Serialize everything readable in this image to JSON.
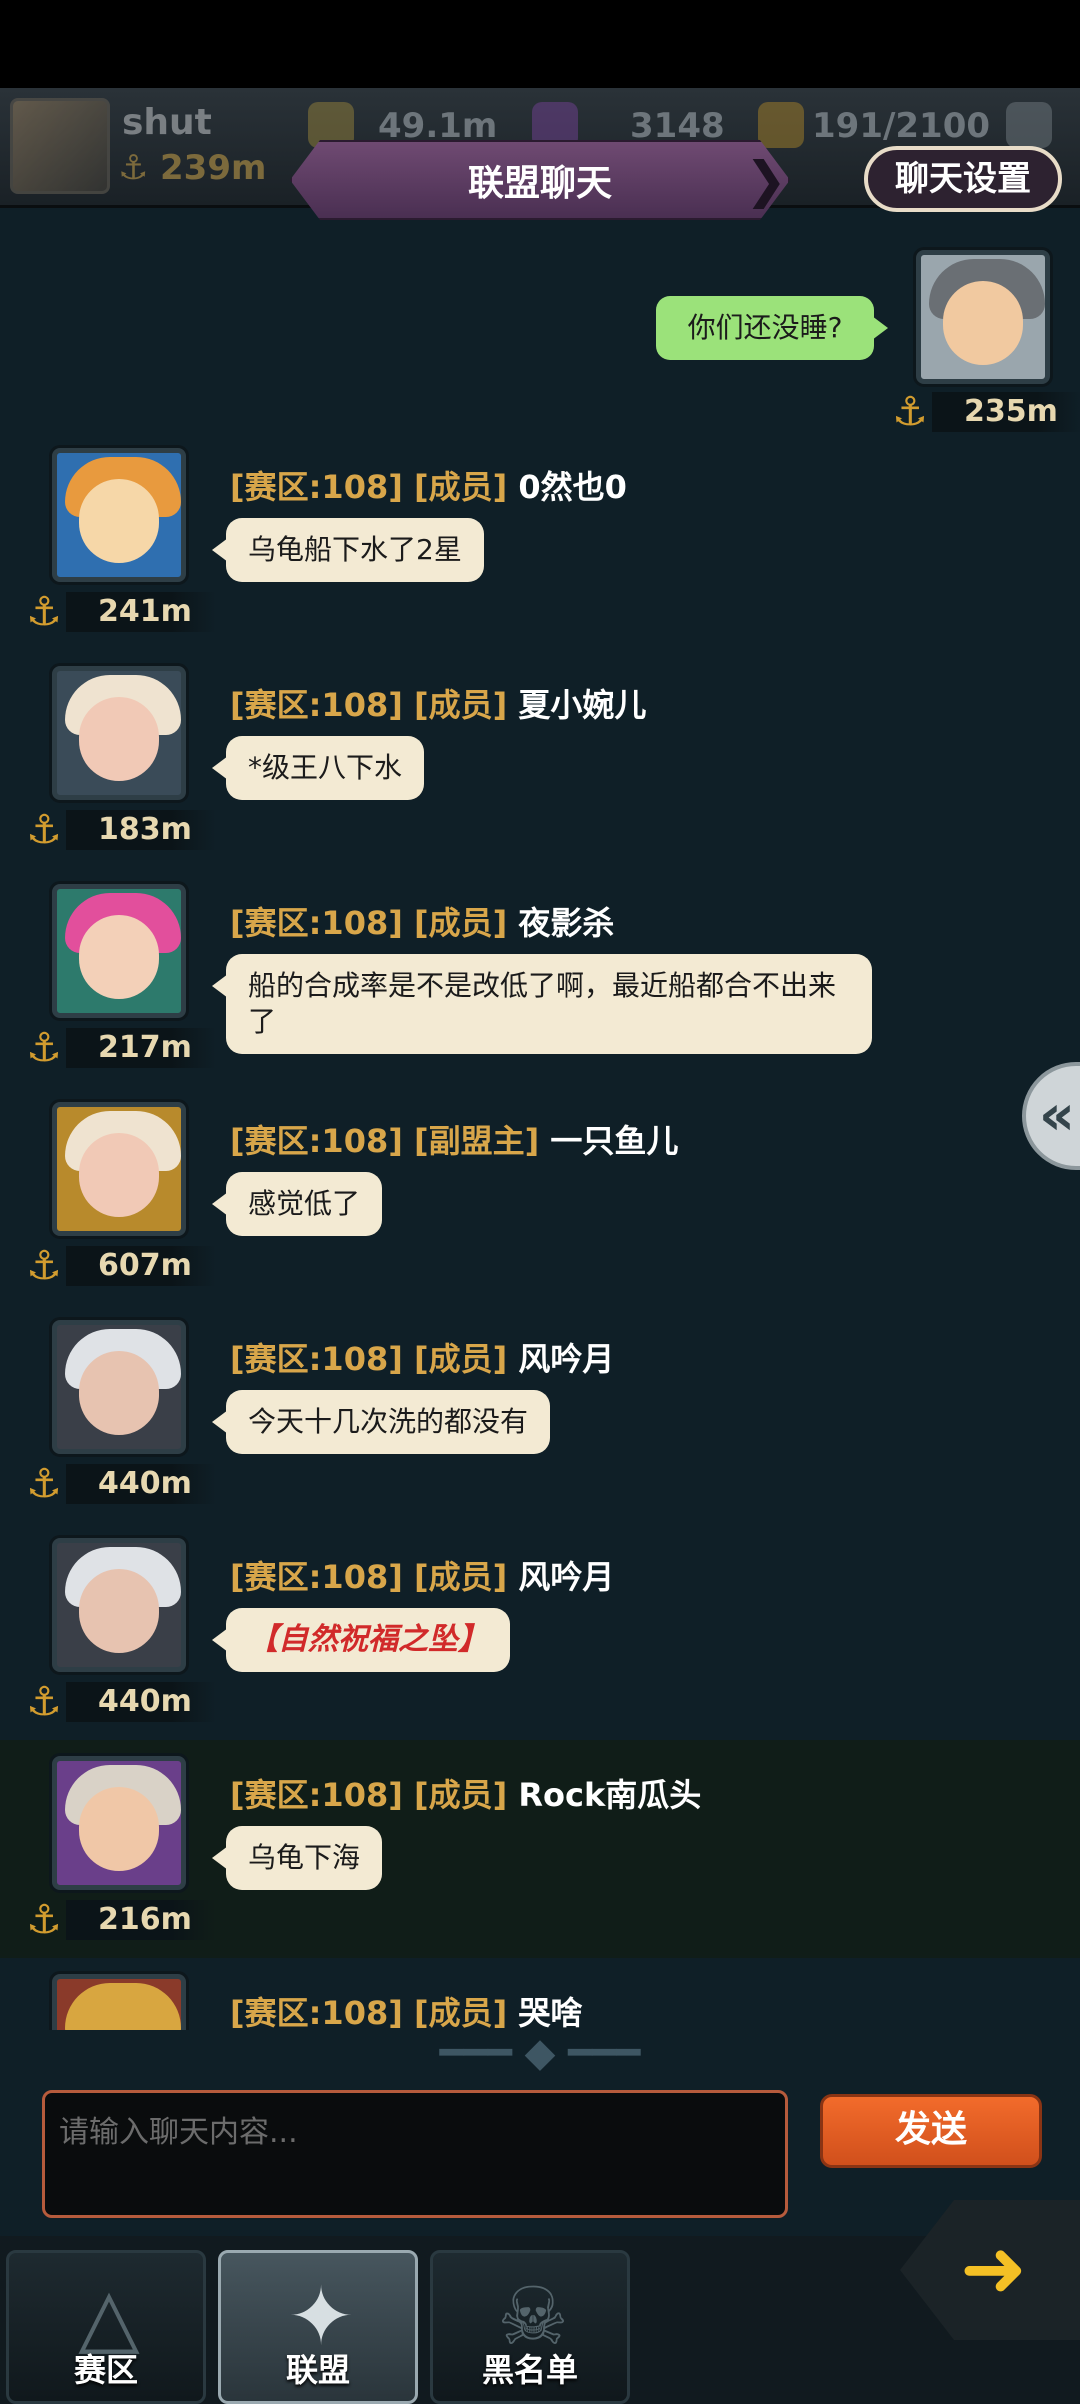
{
  "header": {
    "player_name": "shut",
    "player_power": "239m",
    "gold": "49.1m",
    "gems": "3148",
    "energy": "191/2100",
    "title": "联盟聊天",
    "settings_label": "聊天设置"
  },
  "my_message": {
    "text": "你们还没睡?",
    "power": "235m"
  },
  "messages": [
    {
      "tag1": "[赛区:108]",
      "tag2": "[成员]",
      "name": "0然也0",
      "text": "乌龟船下水了2星",
      "power": "241m"
    },
    {
      "tag1": "[赛区:108]",
      "tag2": "[成员]",
      "name": "夏小婉儿",
      "text": "*级王八下水",
      "power": "183m"
    },
    {
      "tag1": "[赛区:108]",
      "tag2": "[成员]",
      "name": "夜影杀",
      "text": "船的合成率是不是改低了啊，最近船都合不出来了",
      "power": "217m"
    },
    {
      "tag1": "[赛区:108]",
      "tag2": "[副盟主]",
      "name": "一只鱼儿",
      "text": "感觉低了",
      "power": "607m"
    },
    {
      "tag1": "[赛区:108]",
      "tag2": "[成员]",
      "name": "风吟月",
      "text": "今天十几次洗的都没有",
      "power": "440m"
    },
    {
      "tag1": "[赛区:108]",
      "tag2": "[成员]",
      "name": "风吟月",
      "text": "【自然祝福之坠】",
      "power": "440m"
    },
    {
      "tag1": "[赛区:108]",
      "tag2": "[成员]",
      "name": "Rock南瓜头",
      "text": "乌龟下海",
      "power": "216m"
    },
    {
      "tag1": "[赛区:108]",
      "tag2": "[成员]",
      "name": "哭啥",
      "text": "",
      "power": ""
    }
  ],
  "input": {
    "placeholder": "请输入聊天内容..."
  },
  "send_label": "发送",
  "nav": {
    "zone": "赛区",
    "alliance": "联盟",
    "blacklist": "黑名单"
  },
  "colors": {
    "accent": "#d8a64a",
    "send": "#f26b2b",
    "my_bubble": "#9be27a",
    "bubble": "#f3ead3"
  }
}
